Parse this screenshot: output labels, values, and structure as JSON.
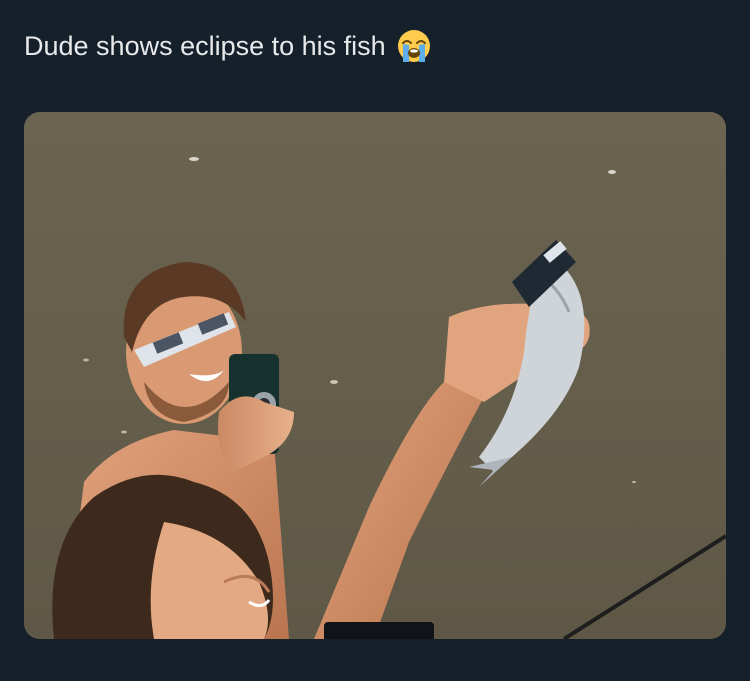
{
  "post": {
    "text": "Dude shows eclipse to his fish",
    "emoji": "loudly-crying-face-emoji"
  },
  "media": {
    "type": "photo",
    "icon": "photo-image"
  },
  "colors": {
    "background": "#15202b",
    "text": "#e7e9ea",
    "water": "#67604c"
  }
}
